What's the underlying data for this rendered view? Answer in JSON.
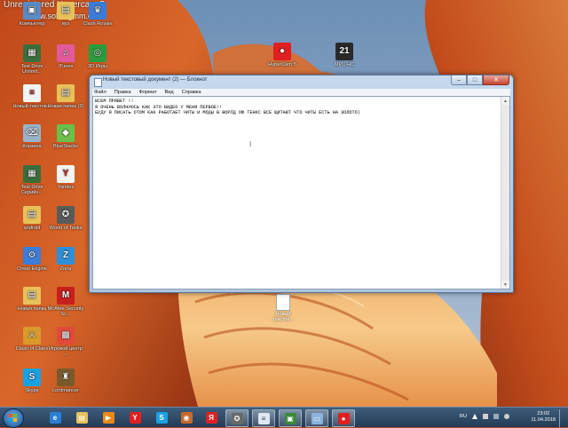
{
  "watermark": {
    "line1": "Unregistered Hypercam 5",
    "line2": "www.solveigmm.com"
  },
  "desktop_icons": [
    {
      "id": "computer",
      "label": "Компьютер",
      "color": "#5b8bc4",
      "glyph": "▣"
    },
    {
      "id": "vuz",
      "label": "вуз",
      "color": "#e8c15a",
      "glyph": "▤"
    },
    {
      "id": "clash-royale",
      "label": "Clash Royale",
      "color": "#3c7bd6",
      "glyph": "♛"
    },
    {
      "id": "test-drive-unlimited",
      "label": "Test Drive Unlimit...",
      "color": "#3a6e3a",
      "glyph": "▦"
    },
    {
      "id": "itunes",
      "label": "iTunes",
      "color": "#e35a9c",
      "glyph": "♫"
    },
    {
      "id": "3d",
      "label": "3D Игры",
      "color": "#2b9b3b",
      "glyph": "◎"
    },
    {
      "id": "new-text",
      "label": "Новый текстов...",
      "color": "#f4f4f4",
      "glyph": "≡"
    },
    {
      "id": "new-folder-2",
      "label": "Новая папка (2)",
      "color": "#e8c15a",
      "glyph": "▤"
    },
    {
      "id": "recycle-bin",
      "label": "Корзина",
      "color": "#9ab3c8",
      "glyph": "⌫"
    },
    {
      "id": "bluestacks",
      "label": "BlueStacks",
      "color": "#6cc04a",
      "glyph": "◆"
    },
    {
      "id": "test-drive-serial",
      "label": "Test Drive Серийн...",
      "color": "#3a6e3a",
      "glyph": "▦"
    },
    {
      "id": "yandex",
      "label": "Yandex",
      "color": "#f4f4f4",
      "glyph": "Y"
    },
    {
      "id": "android",
      "label": "android",
      "color": "#e8c15a",
      "glyph": "▤"
    },
    {
      "id": "world-of-tanks",
      "label": "World of Tanks",
      "color": "#5a5a5a",
      "glyph": "✪"
    },
    {
      "id": "cheat-engine",
      "label": "Cheat Engine",
      "color": "#3b7dd8",
      "glyph": "⚙"
    },
    {
      "id": "zona",
      "label": "Zona",
      "color": "#2e8fd8",
      "glyph": "Z"
    },
    {
      "id": "new-folder",
      "label": "Новая папка",
      "color": "#e8c15a",
      "glyph": "▤"
    },
    {
      "id": "mcafee",
      "label": "McAfee Security Sc...",
      "color": "#c8201e",
      "glyph": "M"
    },
    {
      "id": "clash-of-clans",
      "label": "Clash of Clans",
      "color": "#d89a2a",
      "glyph": "⚔"
    },
    {
      "id": "game-center",
      "label": "Игровой центр ...",
      "color": "#e04a3a",
      "glyph": "▩"
    },
    {
      "id": "skype",
      "label": "Skype",
      "color": "#19a1e6",
      "glyph": "S"
    },
    {
      "id": "lordmancer",
      "label": "Lordmancer",
      "color": "#7a5a2a",
      "glyph": "♜"
    },
    {
      "id": "hypercam",
      "label": "HyperCam 5",
      "color": "#e02020",
      "glyph": "●"
    },
    {
      "id": "mpc-hc",
      "label": "MPC-HC",
      "color": "#2a2a2a",
      "glyph": "21"
    }
  ],
  "file_icon": {
    "label": "Новый текстов..."
  },
  "notepad": {
    "title": "Новый текстовый документ (2) — Блокнот",
    "menu": [
      "Файл",
      "Правка",
      "Формат",
      "Вид",
      "Справка"
    ],
    "text": "ВСЕМ ПРИВЕТ !!\nЯ ОЧЕНЬ ВОЛНУЮСЬ КАК ЭТО ВИДЕО У МЕНЯ ПЕРВОЕ!!\nБУДУ Я ПИСАТЬ ОТОМ КАК РАБОТАЕТ ЧИТЫ И МОДЫ В ВОРЛД ОФ ТЕНКС ВСЕ ЩИТАЮТ ЧТО ЧИТЫ ЕСТЬ НА ЗОЛОТО|",
    "buttons": {
      "minimize": "–",
      "maximize": "□",
      "close": "✕"
    }
  },
  "taskbar": {
    "items": [
      {
        "id": "explorer-ie",
        "glyph": "e",
        "color": "#2a7fd4"
      },
      {
        "id": "folders",
        "glyph": "▤",
        "color": "#e8c15a"
      },
      {
        "id": "media",
        "glyph": "▶",
        "color": "#e88a1a"
      },
      {
        "id": "yandex",
        "glyph": "Y",
        "color": "#e02020"
      },
      {
        "id": "skype",
        "glyph": "S",
        "color": "#19a1e6"
      },
      {
        "id": "game",
        "glyph": "◉",
        "color": "#c86a2a"
      },
      {
        "id": "yandex-2",
        "glyph": "Я",
        "color": "#e02020"
      },
      {
        "id": "wot",
        "glyph": "✪",
        "color": "#6a6a6a"
      },
      {
        "id": "notepad",
        "glyph": "≡",
        "color": "#dfe8f2"
      },
      {
        "id": "monitor",
        "glyph": "▣",
        "color": "#3a8a3a"
      },
      {
        "id": "window",
        "glyph": "▭",
        "color": "#8ab2da"
      },
      {
        "id": "hypercam",
        "glyph": "●",
        "color": "#e02020"
      }
    ],
    "lang": "RU",
    "time": "23:02",
    "date": "11.04.2018"
  }
}
